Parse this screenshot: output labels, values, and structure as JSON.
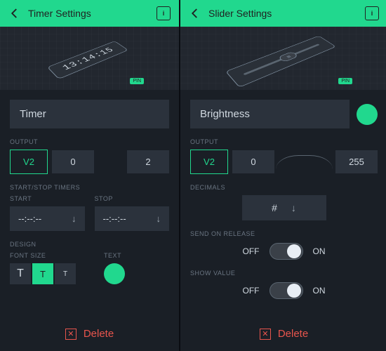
{
  "left": {
    "title": "Timer Settings",
    "hero_time": "13:14:15",
    "pin_tag": "PIN",
    "name": "Timer",
    "sections": {
      "output": "OUTPUT",
      "timers": "START/STOP TIMERS",
      "start": "START",
      "stop": "STOP",
      "design": "DESIGN",
      "font_size": "FONT SIZE",
      "text": "TEXT"
    },
    "output": {
      "pin": "V2",
      "min": "0",
      "max": "2"
    },
    "start_time": "--:--:--",
    "stop_time": "--:--:--",
    "font_selected": 1,
    "delete": "Delete"
  },
  "right": {
    "title": "Slider Settings",
    "pin_tag": "PIN",
    "name": "Brightness",
    "sections": {
      "output": "OUTPUT",
      "decimals": "DECIMALS",
      "send": "SEND ON RELEASE",
      "show": "SHOW VALUE"
    },
    "output": {
      "pin": "V2",
      "min": "0",
      "max": "255"
    },
    "decimals_format": "#",
    "toggle": {
      "off": "OFF",
      "on": "ON"
    },
    "delete": "Delete"
  },
  "colors": {
    "accent": "#21d88e",
    "danger": "#e8554d"
  }
}
